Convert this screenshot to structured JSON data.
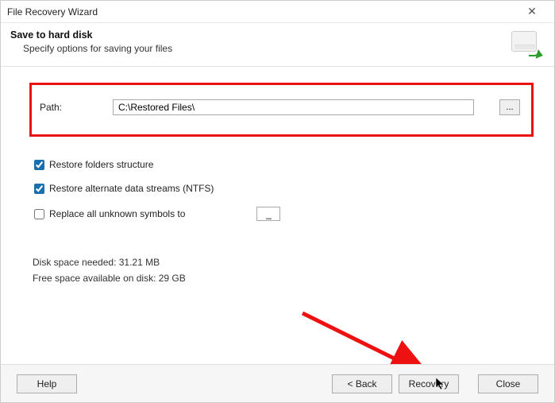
{
  "window": {
    "title": "File Recovery Wizard"
  },
  "header": {
    "title": "Save to hard disk",
    "subtitle": "Specify options for saving your files"
  },
  "path": {
    "label": "Path:",
    "value": "C:\\Restored Files\\",
    "browse_label": "..."
  },
  "options": {
    "restore_folders": {
      "label": "Restore folders structure",
      "checked": true
    },
    "restore_ads": {
      "label": "Restore alternate data streams (NTFS)",
      "checked": true
    },
    "replace_symbols": {
      "label": "Replace all unknown symbols to",
      "checked": false,
      "value": "_"
    }
  },
  "disk": {
    "needed": "Disk space needed: 31.21 MB",
    "free": "Free space available on disk: 29 GB"
  },
  "buttons": {
    "help": "Help",
    "back": "< Back",
    "recovery": "Recovery",
    "close": "Close"
  }
}
